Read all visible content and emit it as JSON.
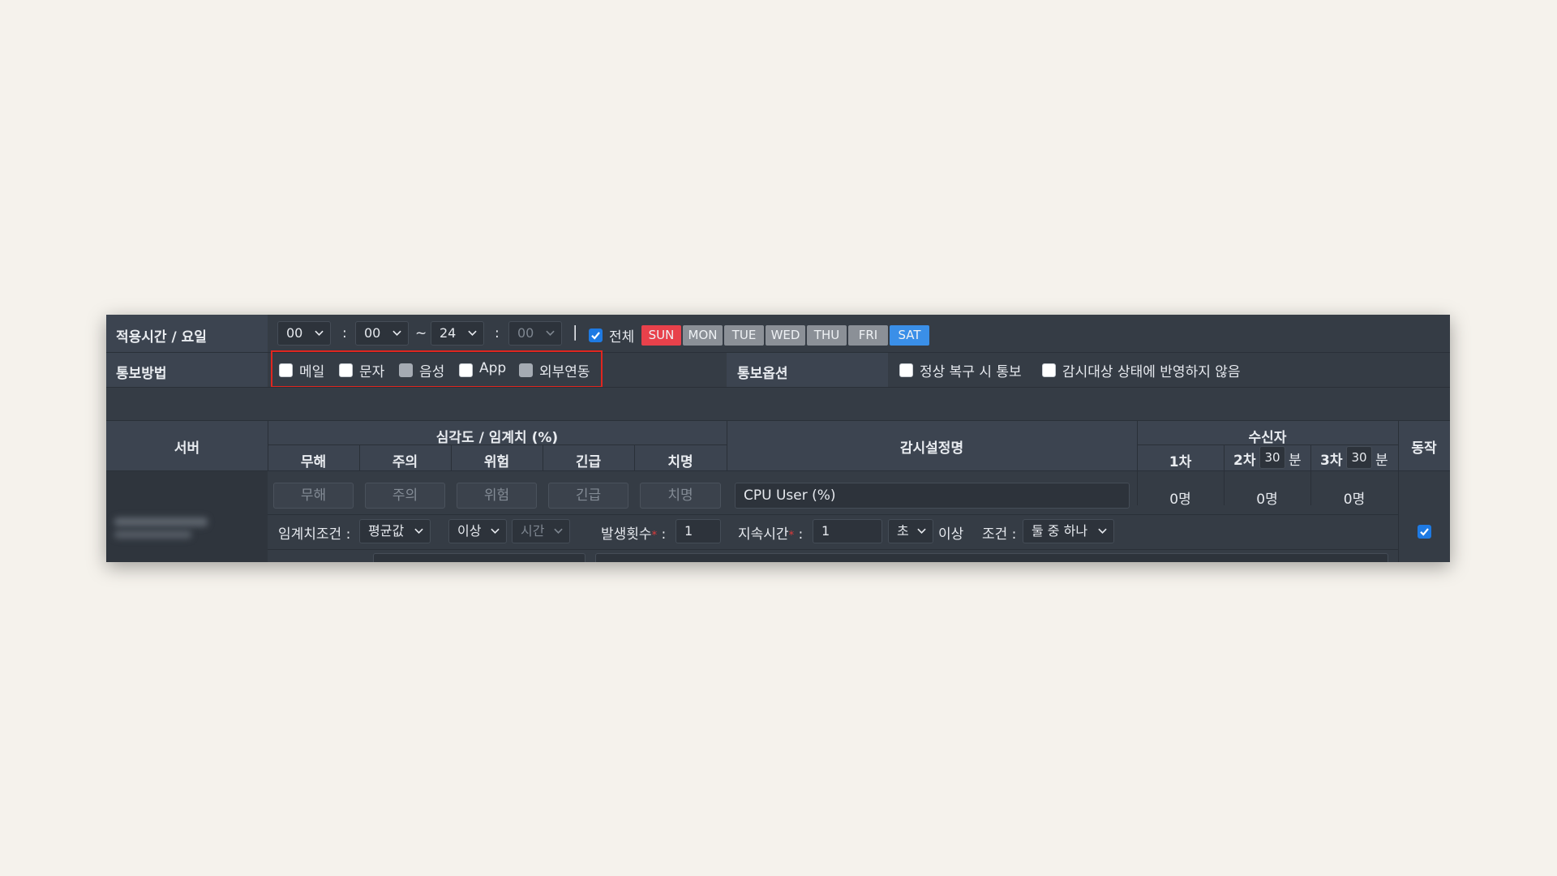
{
  "schedule": {
    "label": "적용시간 / 요일",
    "start_hour": "00",
    "colon1": ":",
    "start_min": "00",
    "tilde": "~",
    "end_hour": "24",
    "colon2": ":",
    "end_min": "00",
    "bar": "|",
    "all_label": "전체",
    "all_checked": true,
    "days": [
      {
        "label": "SUN",
        "color": "#e8414b"
      },
      {
        "label": "MON",
        "color": "#8b9097"
      },
      {
        "label": "TUE",
        "color": "#8b9097"
      },
      {
        "label": "WED",
        "color": "#8b9097"
      },
      {
        "label": "THU",
        "color": "#8b9097"
      },
      {
        "label": "FRI",
        "color": "#8b9097"
      },
      {
        "label": "SAT",
        "color": "#3a8fe8"
      }
    ]
  },
  "notify": {
    "label": "통보방법",
    "methods": [
      {
        "label": "메일",
        "checked": false
      },
      {
        "label": "문자",
        "checked": false
      },
      {
        "label": "음성",
        "checked": false,
        "disabled": true
      },
      {
        "label": "App",
        "checked": false
      },
      {
        "label": "외부연동",
        "checked": false,
        "disabled": true
      }
    ],
    "options_label": "통보옵션",
    "options": [
      {
        "label": "정상 복구 시 통보",
        "checked": false
      },
      {
        "label": "감시대상 상태에 반영하지 않음",
        "checked": false
      }
    ],
    "highlight_color": "#e0261f"
  },
  "table": {
    "server_header": "서버",
    "severity_header": "심각도 / 임계치 (%)",
    "severity_levels": [
      "무해",
      "주의",
      "위험",
      "긴급",
      "치명"
    ],
    "monitor_name_header": "감시설정명",
    "recipients_header": "수신자",
    "recipient_stage1": "1차",
    "recipient_stage2": "2차",
    "recipient_stage2_minutes": "30",
    "recipient_stage3": "3차",
    "recipient_stage3_minutes": "30",
    "minutes_unit": "분",
    "action_header": "동작"
  },
  "row": {
    "threshold_placeholders": [
      "무해",
      "주의",
      "위험",
      "긴급",
      "치명"
    ],
    "monitor_name": "CPU User (%)",
    "recipients": [
      "0명",
      "0명",
      "0명"
    ],
    "condition_label": "임계치조건 :",
    "aggregate": "평균값",
    "comparison": "이상",
    "time_select": "시간",
    "occurrence_label": "발생횟수",
    "occurrence_value": "1",
    "duration_label": "지속시간",
    "duration_value": "1",
    "duration_unit": "초",
    "duration_suffix": "이상",
    "required_mark": "*",
    "colon": ":",
    "cond_label": "조건 :",
    "cond_value": "둘 중 하나",
    "action_checked": true
  },
  "accent_color": "#1e7ae3"
}
